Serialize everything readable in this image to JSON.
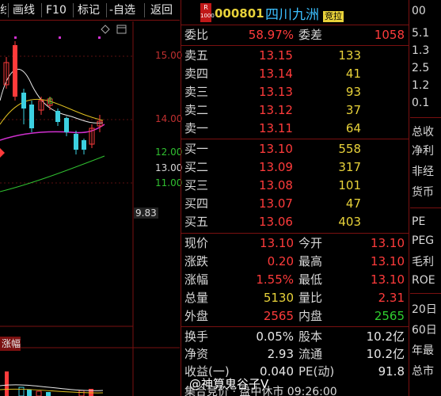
{
  "toolbar": {
    "items": [
      "画线",
      "F10",
      "标记",
      "-自选",
      "返回"
    ]
  },
  "chart": {
    "price_labels": [
      "15.00",
      "14.00",
      "13.00",
      "12.00",
      "11.00",
      "9.83"
    ],
    "bottom_label": "涨幅"
  },
  "header": {
    "code": "000801",
    "name": "四川九洲",
    "badge_top": "R",
    "badge_num": "1000",
    "auction_badge": "竞拉"
  },
  "commission": {
    "ratio_label": "委比",
    "ratio_value": "58.97%",
    "diff_label": "委差",
    "diff_value": "1058"
  },
  "sell_orders": [
    {
      "label": "卖五",
      "price": "13.15",
      "volume": "133"
    },
    {
      "label": "卖四",
      "price": "13.14",
      "volume": "41"
    },
    {
      "label": "卖三",
      "price": "13.13",
      "volume": "93"
    },
    {
      "label": "卖二",
      "price": "13.12",
      "volume": "37"
    },
    {
      "label": "卖一",
      "price": "13.11",
      "volume": "64"
    }
  ],
  "buy_orders": [
    {
      "label": "买一",
      "price": "13.10",
      "volume": "558"
    },
    {
      "label": "买二",
      "price": "13.09",
      "volume": "317"
    },
    {
      "label": "买三",
      "price": "13.08",
      "volume": "101"
    },
    {
      "label": "买四",
      "price": "13.07",
      "volume": "47"
    },
    {
      "label": "买五",
      "price": "13.06",
      "volume": "403"
    }
  ],
  "stats": [
    {
      "l1": "现价",
      "v1": "13.10",
      "l2": "今开",
      "v2": "13.10"
    },
    {
      "l1": "涨跌",
      "v1": "0.20",
      "l2": "最高",
      "v2": "13.10"
    },
    {
      "l1": "涨幅",
      "v1": "1.55%",
      "l2": "最低",
      "v2": "13.10"
    },
    {
      "l1": "总量",
      "v1": "5130",
      "l2": "量比",
      "v2": "2.31"
    },
    {
      "l1": "外盘",
      "v1": "2565",
      "l2": "内盘",
      "v2": "2565"
    }
  ],
  "fundamentals": [
    {
      "l1": "换手",
      "v1": "0.05%",
      "l2": "股本",
      "v2": "10.2亿"
    },
    {
      "l1": "净资",
      "v1": "2.93",
      "l2": "流通",
      "v2": "10.2亿"
    },
    {
      "l1": "收益(一)",
      "v1": "0.040",
      "l2": "PE(动)",
      "v2": "91.8"
    }
  ],
  "status_line": "集合竞价 · 盘中休市 09:26:00",
  "watermark": "@神算鬼谷子V",
  "side_panel": {
    "items": [
      "00",
      "5.1",
      "1.3",
      "2.5",
      "1.2",
      "0.1",
      "总收",
      "净利",
      "非经",
      "货币",
      "PE",
      "PEG",
      "毛利",
      "ROE",
      "20日",
      "60日",
      "年最",
      "总市"
    ]
  },
  "colors": {
    "up": "#ff3b3b",
    "down": "#2fcf2f",
    "volume": "#e8d23a",
    "divider": "#7a1010",
    "name": "#3cc0ff"
  }
}
